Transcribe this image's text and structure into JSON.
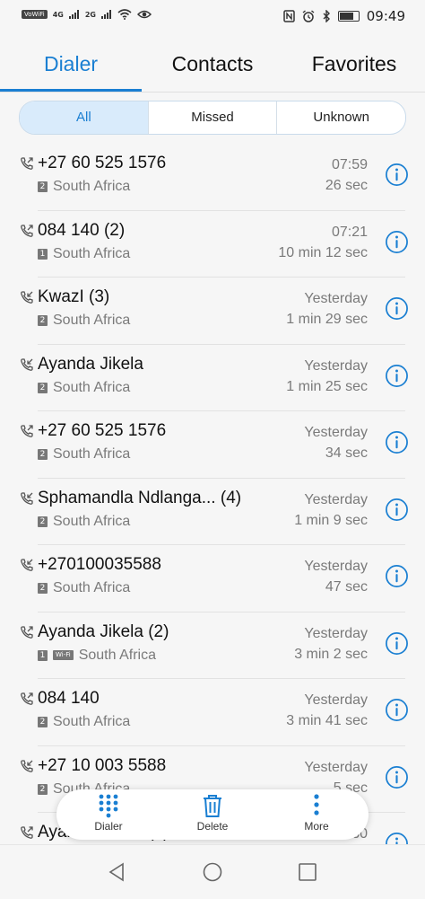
{
  "status_bar": {
    "volte": "VoWiFi",
    "net1": "4G",
    "net2": "2G",
    "time": "09:49",
    "icons": [
      "signal-icon",
      "wifi-icon",
      "eye-icon",
      "nfc-icon",
      "alarm-icon",
      "bluetooth-icon",
      "battery-icon"
    ]
  },
  "tabs": [
    {
      "label": "Dialer"
    },
    {
      "label": "Contacts"
    },
    {
      "label": "Favorites"
    }
  ],
  "filters": [
    {
      "label": "All"
    },
    {
      "label": "Missed"
    },
    {
      "label": "Unknown"
    }
  ],
  "calls": [
    {
      "name": "+27 60 525 1576",
      "sim": "2",
      "wifi": "",
      "location": "South Africa",
      "time": "07:59",
      "duration": "26 sec",
      "direction": "outgoing"
    },
    {
      "name": "084 140 (2)",
      "sim": "1",
      "wifi": "",
      "location": "South Africa",
      "time": "07:21",
      "duration": "10 min 12 sec",
      "direction": "outgoing"
    },
    {
      "name": "KwazI (3)",
      "sim": "2",
      "wifi": "",
      "location": "South Africa",
      "time": "Yesterday",
      "duration": "1 min 29 sec",
      "direction": "incoming"
    },
    {
      "name": "Ayanda Jikela",
      "sim": "2",
      "wifi": "",
      "location": "South Africa",
      "time": "Yesterday",
      "duration": "1 min 25 sec",
      "direction": "incoming"
    },
    {
      "name": "+27 60 525 1576",
      "sim": "2",
      "wifi": "",
      "location": "South Africa",
      "time": "Yesterday",
      "duration": "34 sec",
      "direction": "outgoing"
    },
    {
      "name": "Sphamandla Ndlanga... (4)",
      "sim": "2",
      "wifi": "",
      "location": "South Africa",
      "time": "Yesterday",
      "duration": "1 min 9 sec",
      "direction": "incoming"
    },
    {
      "name": "+270100035588",
      "sim": "2",
      "wifi": "",
      "location": "South Africa",
      "time": "Yesterday",
      "duration": "47 sec",
      "direction": "incoming"
    },
    {
      "name": "Ayanda Jikela (2)",
      "sim": "1",
      "wifi": "Wi-Fi",
      "location": "South Africa",
      "time": "Yesterday",
      "duration": "3 min 2 sec",
      "direction": "outgoing"
    },
    {
      "name": "084 140",
      "sim": "2",
      "wifi": "",
      "location": "South Africa",
      "time": "Yesterday",
      "duration": "3 min 41 sec",
      "direction": "outgoing"
    },
    {
      "name": "+27 10 003 5588",
      "sim": "2",
      "wifi": "",
      "location": "South Africa",
      "time": "Yesterday",
      "duration": "5 sec",
      "direction": "incoming"
    },
    {
      "name": "Ayanda Jikela (2)",
      "sim": "",
      "wifi": "",
      "location": "",
      "time": "9/30",
      "duration": "",
      "direction": "outgoing"
    }
  ],
  "toolbar": {
    "dialer_label": "Dialer",
    "delete_label": "Delete",
    "more_label": "More"
  },
  "colors": {
    "accent": "#1a7fd2",
    "segment_active_bg": "#d9ebfb",
    "secondary_text": "#7a7a7a"
  }
}
